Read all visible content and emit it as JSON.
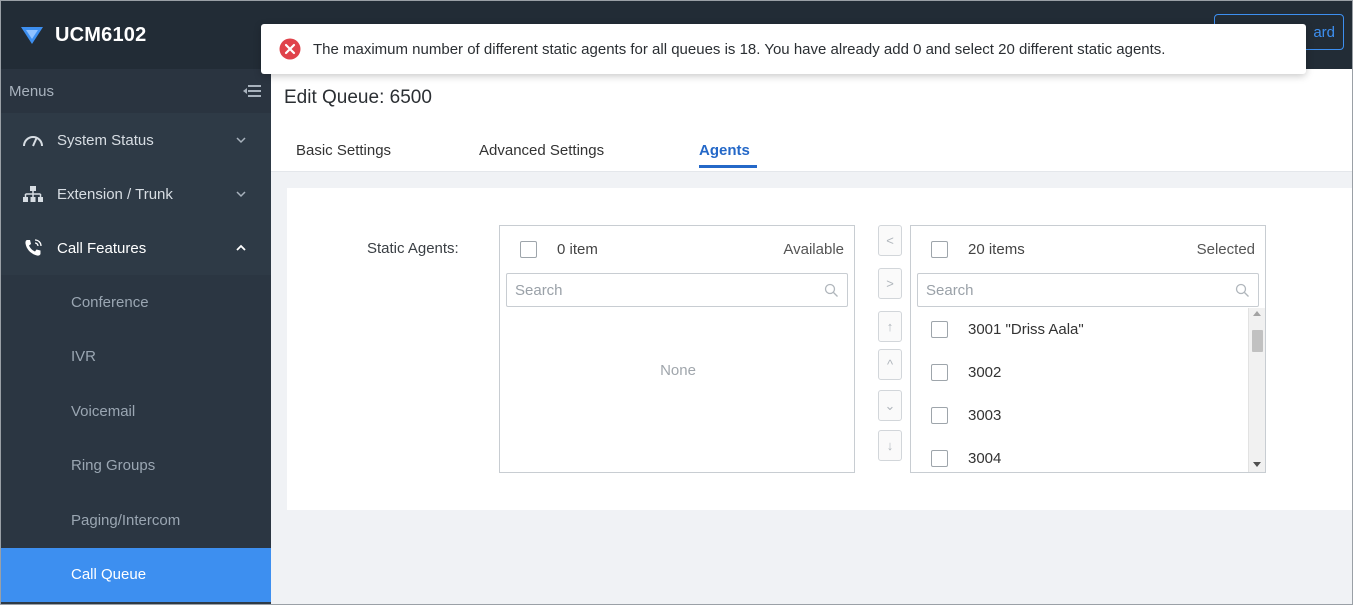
{
  "brand": {
    "name": "UCM6102"
  },
  "topbar": {
    "wizard_label": "ard"
  },
  "toast": {
    "message": "The maximum number of different static agents for all queues is 18. You have already add 0 and select 20 different static agents."
  },
  "sidebar": {
    "menus_label": "Menus",
    "items": [
      {
        "label": "System Status",
        "icon": "gauge-icon",
        "expanded": false
      },
      {
        "label": "Extension / Trunk",
        "icon": "network-icon",
        "expanded": false
      },
      {
        "label": "Call Features",
        "icon": "phone-icon",
        "expanded": true
      }
    ],
    "subitems": [
      {
        "label": "Conference"
      },
      {
        "label": "IVR"
      },
      {
        "label": "Voicemail"
      },
      {
        "label": "Ring Groups"
      },
      {
        "label": "Paging/Intercom"
      },
      {
        "label": "Call Queue",
        "active": true
      }
    ]
  },
  "page": {
    "title": "Edit Queue: 6500",
    "tabs": [
      {
        "label": "Basic Settings"
      },
      {
        "label": "Advanced Settings"
      },
      {
        "label": "Agents",
        "active": true
      }
    ]
  },
  "agents": {
    "field_label": "Static Agents:",
    "available": {
      "count_label": "0 item",
      "title": "Available",
      "search_placeholder": "Search",
      "empty_text": "None"
    },
    "selected": {
      "count_label": "20 items",
      "title": "Selected",
      "search_placeholder": "Search",
      "items": [
        "3001 \"Driss Aala\"",
        "3002",
        "3003",
        "3004"
      ]
    },
    "transfer_buttons": [
      "<",
      ">",
      "↑",
      "^",
      "⌄",
      "↓"
    ]
  },
  "colors": {
    "sidebar_bg": "#2e3a46",
    "header_bg": "#222c36",
    "accent": "#3d8ff0",
    "tab_active": "#2468c8",
    "error": "#e0434b"
  }
}
